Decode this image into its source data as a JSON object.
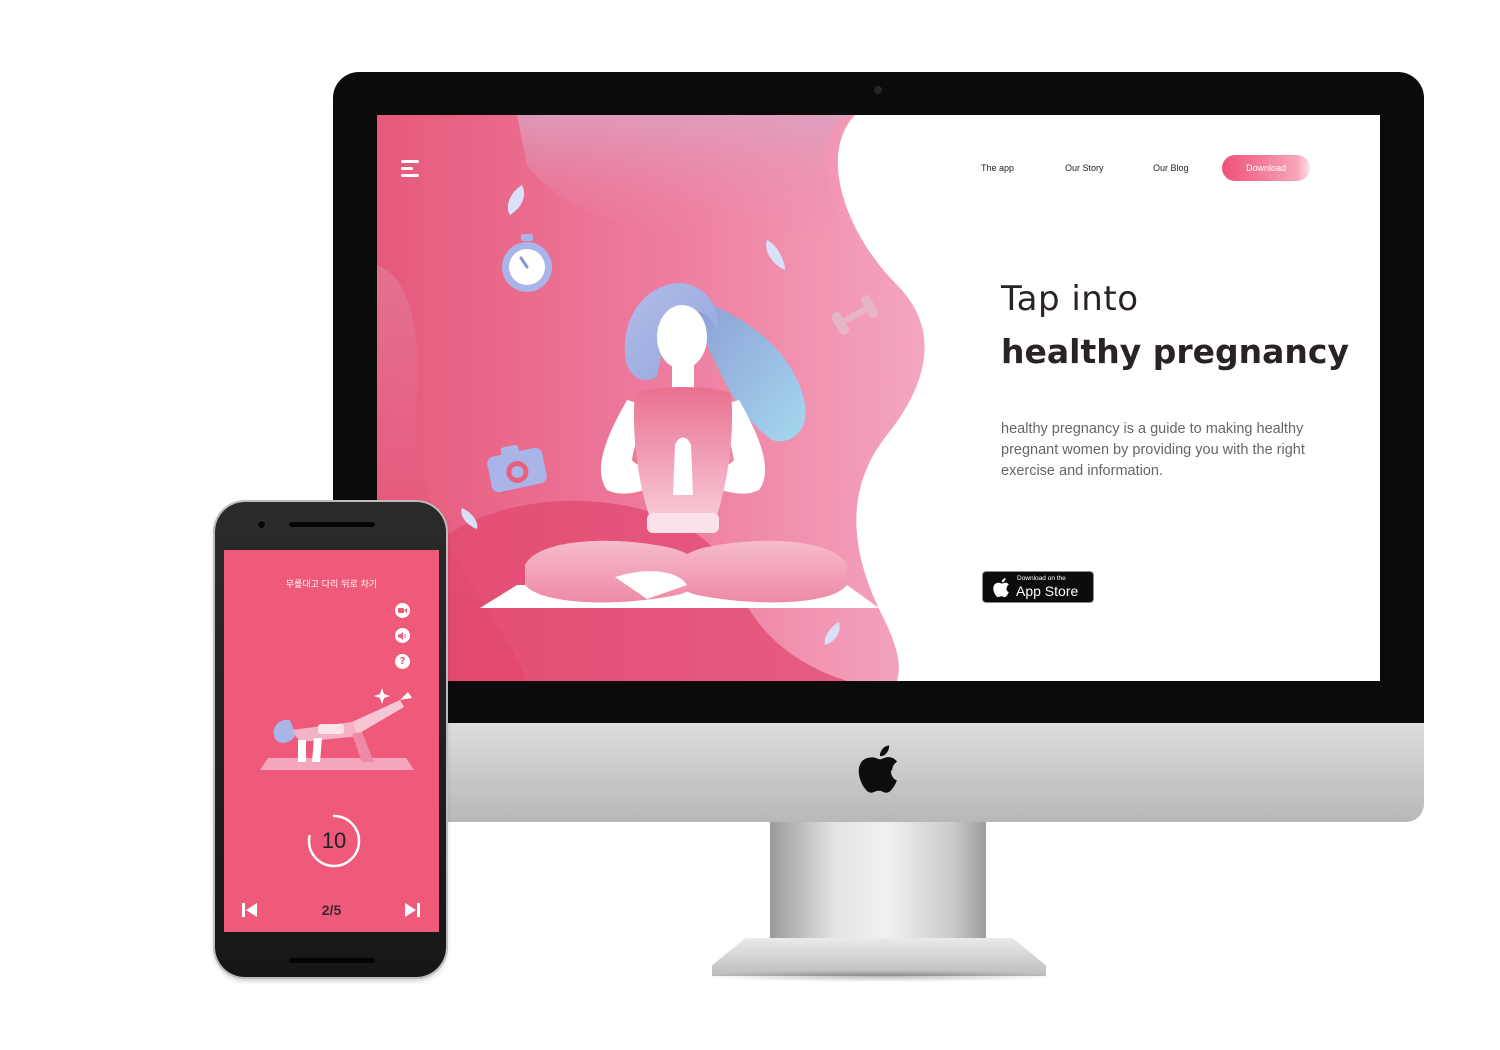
{
  "website": {
    "nav": {
      "items": [
        "The app",
        "Our Story",
        "Our Blog"
      ],
      "download_label": "Download"
    },
    "hero": {
      "title_light": "Tap into",
      "title_bold": "healthy pregnancy",
      "description": "healthy pregnancy is a guide to making healthy pregnant women by providing you with the right exercise and information."
    },
    "app_store_badge": {
      "small_text": "Download on the",
      "big_text": "App Store"
    }
  },
  "phone_app": {
    "exercise_title": "무릎대고 다리 뒤로 차기",
    "timer_count": "10",
    "progress": "2/5",
    "timer_fraction": 0.78,
    "icons": [
      "video-camera-icon",
      "speaker-icon",
      "help-icon",
      "previous-icon",
      "next-icon"
    ]
  },
  "colors": {
    "brand_pink": "#ef5a7a",
    "hero_gradient_dark": "#e8466d",
    "hero_gradient_light": "#f4a4bc",
    "hair_blue": "#a9b4e8",
    "text_dark": "#2a2323",
    "text_gray": "#666666"
  }
}
